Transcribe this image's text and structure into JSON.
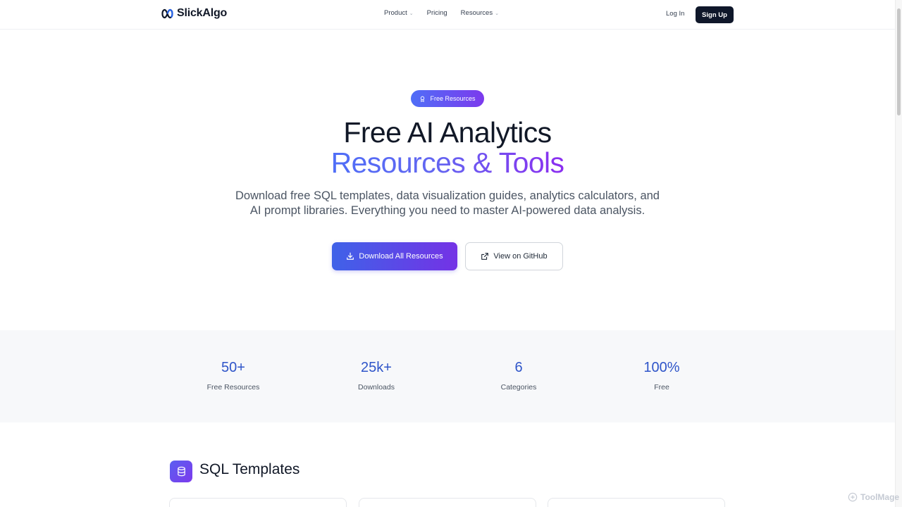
{
  "nav": {
    "brand": "SlickAlgo",
    "links": [
      {
        "label": "Product",
        "dropdown": true
      },
      {
        "label": "Pricing",
        "dropdown": false
      },
      {
        "label": "Resources",
        "dropdown": true
      }
    ],
    "login": "Log In",
    "signup": "Sign Up"
  },
  "hero": {
    "badge": "Free Resources",
    "title_line1": "Free AI Analytics",
    "title_line2": "Resources & Tools",
    "subtitle": "Download free SQL templates, data visualization guides, analytics calculators, and AI prompt libraries. Everything you need to master AI-powered data analysis.",
    "primary_button": "Download All Resources",
    "secondary_button": "View on GitHub"
  },
  "stats": [
    {
      "value": "50+",
      "label": "Free Resources"
    },
    {
      "value": "25k+",
      "label": "Downloads"
    },
    {
      "value": "6",
      "label": "Categories"
    },
    {
      "value": "100%",
      "label": "Free"
    }
  ],
  "section": {
    "title": "SQL Templates"
  },
  "watermark": "ToolMage",
  "colors": {
    "accent_start": "#4f6ef7",
    "accent_end": "#7c3aed",
    "stat_value": "#2f55c9",
    "dark_button": "#0f172a"
  }
}
